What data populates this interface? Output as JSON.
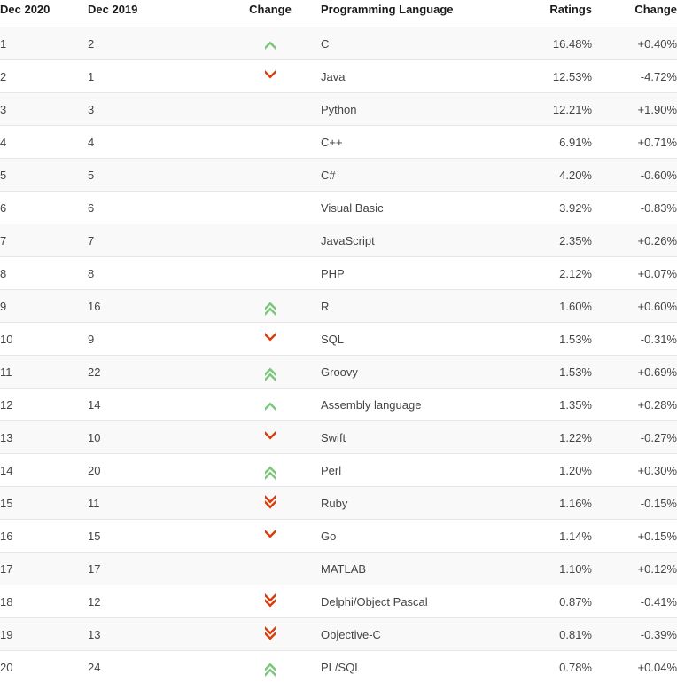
{
  "table": {
    "headers": {
      "rank_now": "Dec 2020",
      "rank_prev": "Dec 2019",
      "change_arrow": "Change",
      "language": "Programming Language",
      "ratings": "Ratings",
      "change_value": "Change"
    },
    "colors": {
      "up": "#79c879",
      "down": "#dd3c0a",
      "header_text": "#1a1a1a",
      "cell_text": "#444444",
      "row_border": "#e6e6e6",
      "zebra_background": "#f9f9f9",
      "background": "#ffffff"
    },
    "rows": [
      {
        "rank_now": "1",
        "rank_prev": "2",
        "change": "up",
        "change_icon": "chevron-up-icon",
        "language": "C",
        "ratings": "16.48%",
        "change_value": "+0.40%"
      },
      {
        "rank_now": "2",
        "rank_prev": "1",
        "change": "down",
        "change_icon": "chevron-down-icon",
        "language": "Java",
        "ratings": "12.53%",
        "change_value": "-4.72%"
      },
      {
        "rank_now": "3",
        "rank_prev": "3",
        "change": "none",
        "change_icon": "",
        "language": "Python",
        "ratings": "12.21%",
        "change_value": "+1.90%"
      },
      {
        "rank_now": "4",
        "rank_prev": "4",
        "change": "none",
        "change_icon": "",
        "language": "C++",
        "ratings": "6.91%",
        "change_value": "+0.71%"
      },
      {
        "rank_now": "5",
        "rank_prev": "5",
        "change": "none",
        "change_icon": "",
        "language": "C#",
        "ratings": "4.20%",
        "change_value": "-0.60%"
      },
      {
        "rank_now": "6",
        "rank_prev": "6",
        "change": "none",
        "change_icon": "",
        "language": "Visual Basic",
        "ratings": "3.92%",
        "change_value": "-0.83%"
      },
      {
        "rank_now": "7",
        "rank_prev": "7",
        "change": "none",
        "change_icon": "",
        "language": "JavaScript",
        "ratings": "2.35%",
        "change_value": "+0.26%"
      },
      {
        "rank_now": "8",
        "rank_prev": "8",
        "change": "none",
        "change_icon": "",
        "language": "PHP",
        "ratings": "2.12%",
        "change_value": "+0.07%"
      },
      {
        "rank_now": "9",
        "rank_prev": "16",
        "change": "up-double",
        "change_icon": "chevron-double-up-icon",
        "language": "R",
        "ratings": "1.60%",
        "change_value": "+0.60%"
      },
      {
        "rank_now": "10",
        "rank_prev": "9",
        "change": "down",
        "change_icon": "chevron-down-icon",
        "language": "SQL",
        "ratings": "1.53%",
        "change_value": "-0.31%"
      },
      {
        "rank_now": "11",
        "rank_prev": "22",
        "change": "up-double",
        "change_icon": "chevron-double-up-icon",
        "language": "Groovy",
        "ratings": "1.53%",
        "change_value": "+0.69%"
      },
      {
        "rank_now": "12",
        "rank_prev": "14",
        "change": "up",
        "change_icon": "chevron-up-icon",
        "language": "Assembly language",
        "ratings": "1.35%",
        "change_value": "+0.28%"
      },
      {
        "rank_now": "13",
        "rank_prev": "10",
        "change": "down",
        "change_icon": "chevron-down-icon",
        "language": "Swift",
        "ratings": "1.22%",
        "change_value": "-0.27%"
      },
      {
        "rank_now": "14",
        "rank_prev": "20",
        "change": "up-double",
        "change_icon": "chevron-double-up-icon",
        "language": "Perl",
        "ratings": "1.20%",
        "change_value": "+0.30%"
      },
      {
        "rank_now": "15",
        "rank_prev": "11",
        "change": "down-double",
        "change_icon": "chevron-double-down-icon",
        "language": "Ruby",
        "ratings": "1.16%",
        "change_value": "-0.15%"
      },
      {
        "rank_now": "16",
        "rank_prev": "15",
        "change": "down",
        "change_icon": "chevron-down-icon",
        "language": "Go",
        "ratings": "1.14%",
        "change_value": "+0.15%"
      },
      {
        "rank_now": "17",
        "rank_prev": "17",
        "change": "none",
        "change_icon": "",
        "language": "MATLAB",
        "ratings": "1.10%",
        "change_value": "+0.12%"
      },
      {
        "rank_now": "18",
        "rank_prev": "12",
        "change": "down-double",
        "change_icon": "chevron-double-down-icon",
        "language": "Delphi/Object Pascal",
        "ratings": "0.87%",
        "change_value": "-0.41%"
      },
      {
        "rank_now": "19",
        "rank_prev": "13",
        "change": "down-double",
        "change_icon": "chevron-double-down-icon",
        "language": "Objective-C",
        "ratings": "0.81%",
        "change_value": "-0.39%"
      },
      {
        "rank_now": "20",
        "rank_prev": "24",
        "change": "up-double",
        "change_icon": "chevron-double-up-icon",
        "language": "PL/SQL",
        "ratings": "0.78%",
        "change_value": "+0.04%"
      }
    ]
  }
}
